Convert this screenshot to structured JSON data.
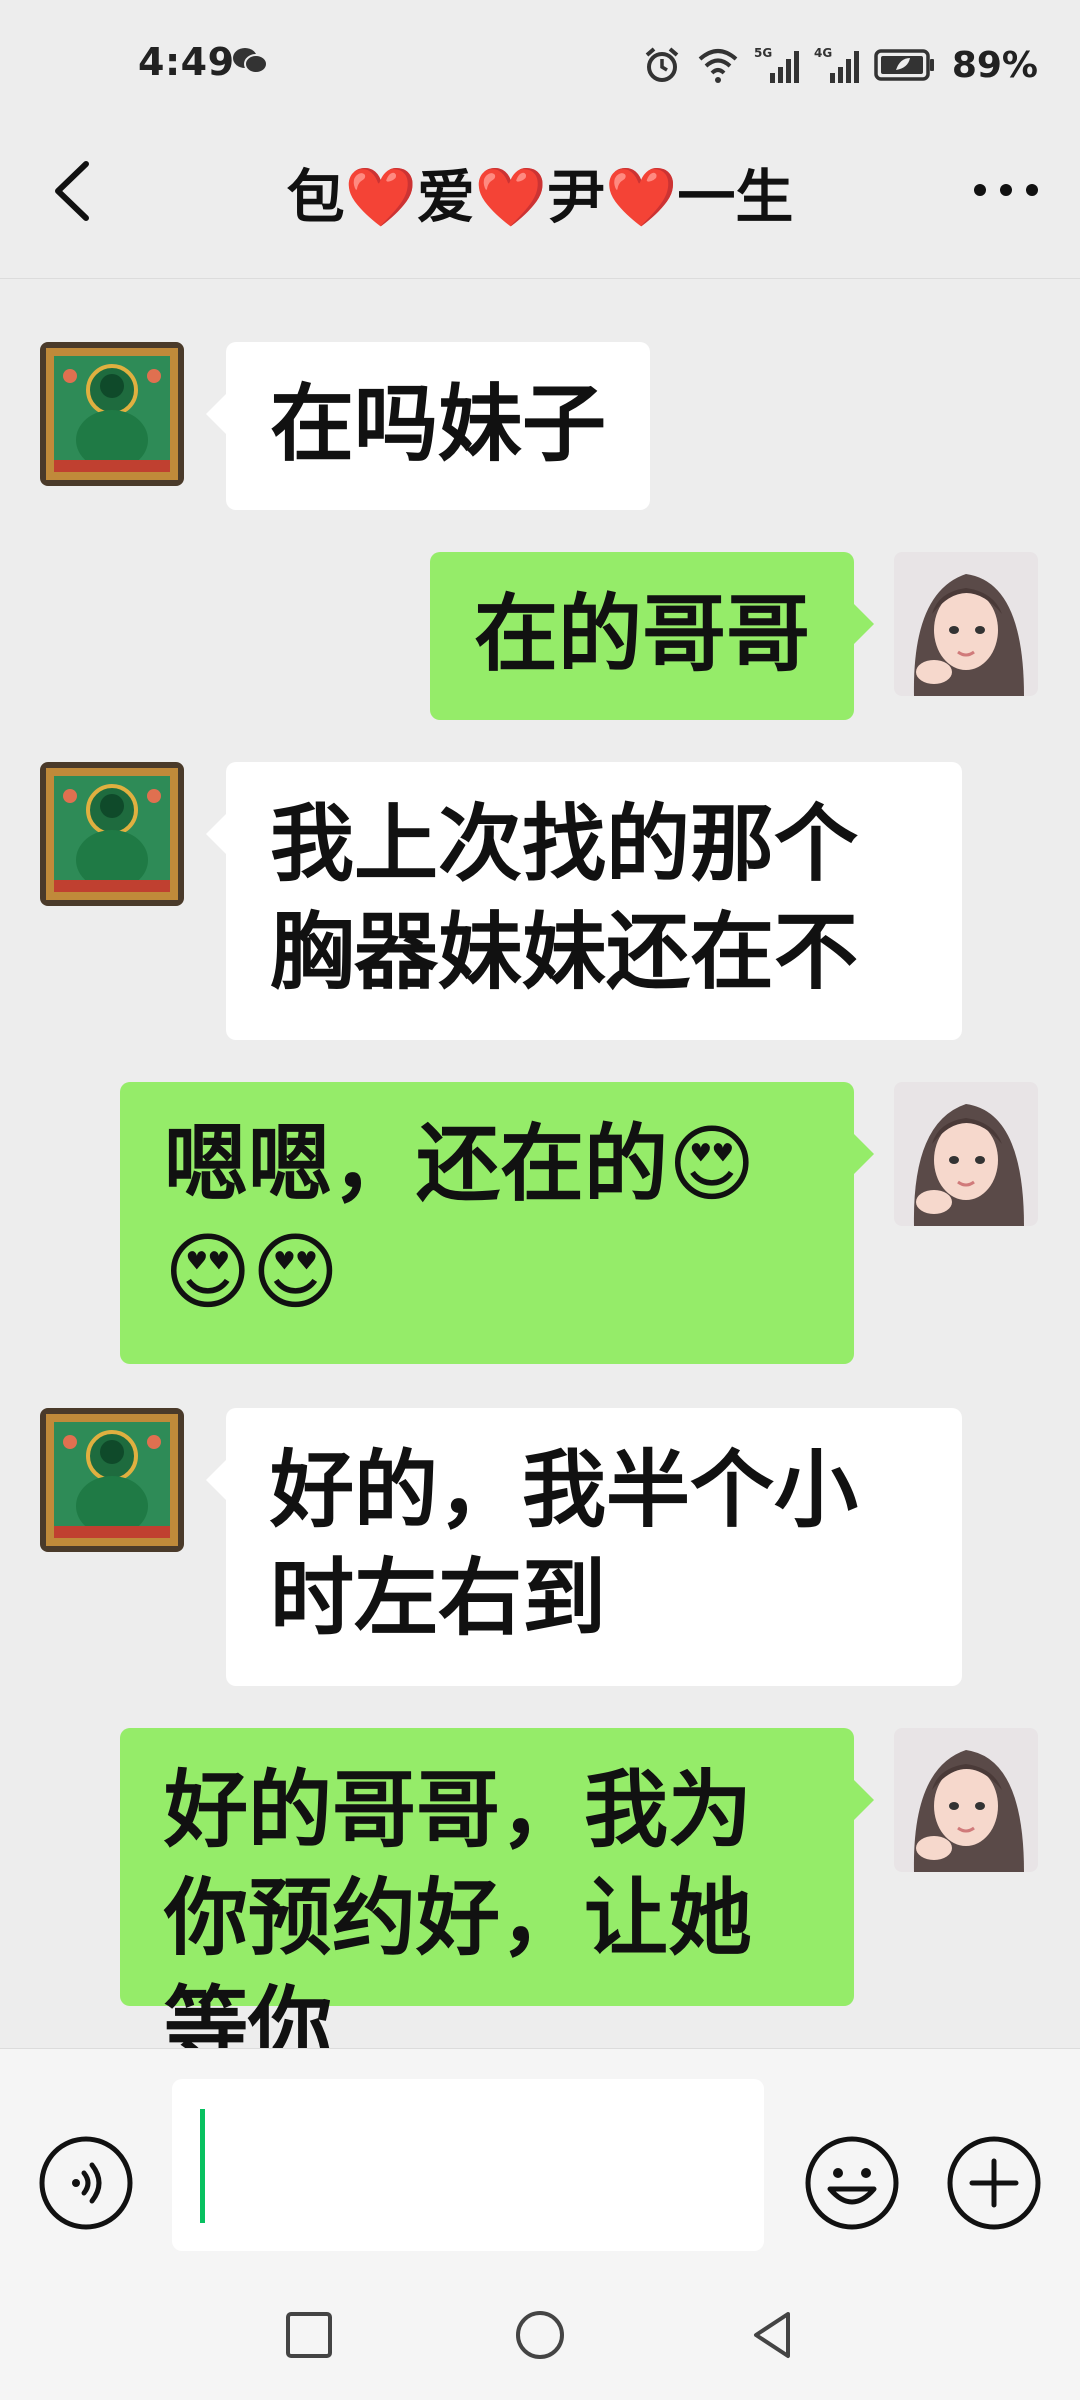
{
  "status_bar": {
    "time": "4:49",
    "battery": "89%",
    "network_1": "5G",
    "network_2": "4G",
    "icons": [
      "wechat-icon",
      "alarm-icon",
      "wifi-icon",
      "signal-5g-icon",
      "signal-4g-icon",
      "battery-icon"
    ]
  },
  "header": {
    "title": "包❤️爱❤️尹❤️一生",
    "back_icon": "chevron-left-icon",
    "more_icon": "more-dots-icon"
  },
  "messages": [
    {
      "direction": "received",
      "text": "在吗妹子"
    },
    {
      "direction": "sent",
      "text": "在的哥哥"
    },
    {
      "direction": "received",
      "text": "我上次找的那个胸器妹妹还在不"
    },
    {
      "direction": "sent",
      "text": "嗯嗯，还在的😍😍😍"
    },
    {
      "direction": "received",
      "text": "好的，我半个小时左右到"
    },
    {
      "direction": "sent",
      "text": "好的哥哥，我为你预约好，让她等你"
    }
  ],
  "input_bar": {
    "value": "",
    "voice_icon": "voice-icon",
    "emoji_icon": "emoji-icon",
    "plus_icon": "plus-icon"
  },
  "nav_bar": {
    "icons": [
      "recents-square-icon",
      "home-circle-icon",
      "back-triangle-icon"
    ]
  },
  "colors": {
    "background": "#ededed",
    "sent_bubble": "#95ec69",
    "received_bubble": "#ffffff",
    "caret": "#07c160"
  }
}
